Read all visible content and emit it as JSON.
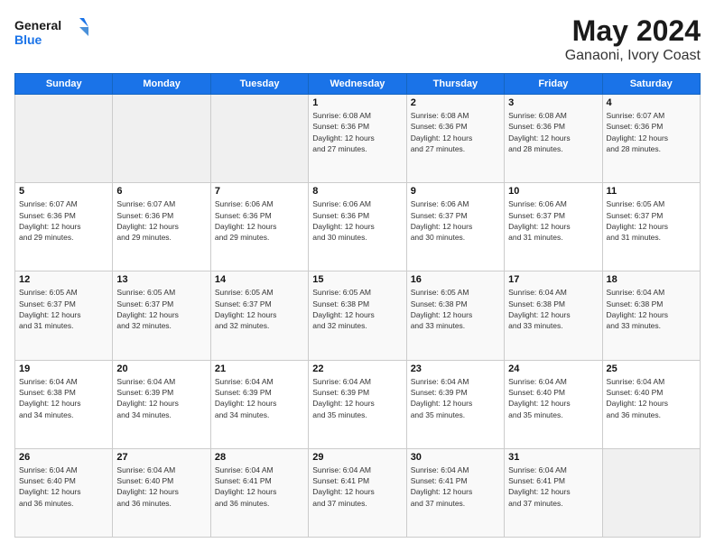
{
  "header": {
    "logo_line1": "General",
    "logo_line2": "Blue",
    "main_title": "May 2024",
    "subtitle": "Ganaoni, Ivory Coast"
  },
  "calendar": {
    "days_of_week": [
      "Sunday",
      "Monday",
      "Tuesday",
      "Wednesday",
      "Thursday",
      "Friday",
      "Saturday"
    ],
    "weeks": [
      [
        {
          "day": "",
          "info": ""
        },
        {
          "day": "",
          "info": ""
        },
        {
          "day": "",
          "info": ""
        },
        {
          "day": "1",
          "info": "Sunrise: 6:08 AM\nSunset: 6:36 PM\nDaylight: 12 hours\nand 27 minutes."
        },
        {
          "day": "2",
          "info": "Sunrise: 6:08 AM\nSunset: 6:36 PM\nDaylight: 12 hours\nand 27 minutes."
        },
        {
          "day": "3",
          "info": "Sunrise: 6:08 AM\nSunset: 6:36 PM\nDaylight: 12 hours\nand 28 minutes."
        },
        {
          "day": "4",
          "info": "Sunrise: 6:07 AM\nSunset: 6:36 PM\nDaylight: 12 hours\nand 28 minutes."
        }
      ],
      [
        {
          "day": "5",
          "info": "Sunrise: 6:07 AM\nSunset: 6:36 PM\nDaylight: 12 hours\nand 29 minutes."
        },
        {
          "day": "6",
          "info": "Sunrise: 6:07 AM\nSunset: 6:36 PM\nDaylight: 12 hours\nand 29 minutes."
        },
        {
          "day": "7",
          "info": "Sunrise: 6:06 AM\nSunset: 6:36 PM\nDaylight: 12 hours\nand 29 minutes."
        },
        {
          "day": "8",
          "info": "Sunrise: 6:06 AM\nSunset: 6:36 PM\nDaylight: 12 hours\nand 30 minutes."
        },
        {
          "day": "9",
          "info": "Sunrise: 6:06 AM\nSunset: 6:37 PM\nDaylight: 12 hours\nand 30 minutes."
        },
        {
          "day": "10",
          "info": "Sunrise: 6:06 AM\nSunset: 6:37 PM\nDaylight: 12 hours\nand 31 minutes."
        },
        {
          "day": "11",
          "info": "Sunrise: 6:05 AM\nSunset: 6:37 PM\nDaylight: 12 hours\nand 31 minutes."
        }
      ],
      [
        {
          "day": "12",
          "info": "Sunrise: 6:05 AM\nSunset: 6:37 PM\nDaylight: 12 hours\nand 31 minutes."
        },
        {
          "day": "13",
          "info": "Sunrise: 6:05 AM\nSunset: 6:37 PM\nDaylight: 12 hours\nand 32 minutes."
        },
        {
          "day": "14",
          "info": "Sunrise: 6:05 AM\nSunset: 6:37 PM\nDaylight: 12 hours\nand 32 minutes."
        },
        {
          "day": "15",
          "info": "Sunrise: 6:05 AM\nSunset: 6:38 PM\nDaylight: 12 hours\nand 32 minutes."
        },
        {
          "day": "16",
          "info": "Sunrise: 6:05 AM\nSunset: 6:38 PM\nDaylight: 12 hours\nand 33 minutes."
        },
        {
          "day": "17",
          "info": "Sunrise: 6:04 AM\nSunset: 6:38 PM\nDaylight: 12 hours\nand 33 minutes."
        },
        {
          "day": "18",
          "info": "Sunrise: 6:04 AM\nSunset: 6:38 PM\nDaylight: 12 hours\nand 33 minutes."
        }
      ],
      [
        {
          "day": "19",
          "info": "Sunrise: 6:04 AM\nSunset: 6:38 PM\nDaylight: 12 hours\nand 34 minutes."
        },
        {
          "day": "20",
          "info": "Sunrise: 6:04 AM\nSunset: 6:39 PM\nDaylight: 12 hours\nand 34 minutes."
        },
        {
          "day": "21",
          "info": "Sunrise: 6:04 AM\nSunset: 6:39 PM\nDaylight: 12 hours\nand 34 minutes."
        },
        {
          "day": "22",
          "info": "Sunrise: 6:04 AM\nSunset: 6:39 PM\nDaylight: 12 hours\nand 35 minutes."
        },
        {
          "day": "23",
          "info": "Sunrise: 6:04 AM\nSunset: 6:39 PM\nDaylight: 12 hours\nand 35 minutes."
        },
        {
          "day": "24",
          "info": "Sunrise: 6:04 AM\nSunset: 6:40 PM\nDaylight: 12 hours\nand 35 minutes."
        },
        {
          "day": "25",
          "info": "Sunrise: 6:04 AM\nSunset: 6:40 PM\nDaylight: 12 hours\nand 36 minutes."
        }
      ],
      [
        {
          "day": "26",
          "info": "Sunrise: 6:04 AM\nSunset: 6:40 PM\nDaylight: 12 hours\nand 36 minutes."
        },
        {
          "day": "27",
          "info": "Sunrise: 6:04 AM\nSunset: 6:40 PM\nDaylight: 12 hours\nand 36 minutes."
        },
        {
          "day": "28",
          "info": "Sunrise: 6:04 AM\nSunset: 6:41 PM\nDaylight: 12 hours\nand 36 minutes."
        },
        {
          "day": "29",
          "info": "Sunrise: 6:04 AM\nSunset: 6:41 PM\nDaylight: 12 hours\nand 37 minutes."
        },
        {
          "day": "30",
          "info": "Sunrise: 6:04 AM\nSunset: 6:41 PM\nDaylight: 12 hours\nand 37 minutes."
        },
        {
          "day": "31",
          "info": "Sunrise: 6:04 AM\nSunset: 6:41 PM\nDaylight: 12 hours\nand 37 minutes."
        },
        {
          "day": "",
          "info": ""
        }
      ]
    ]
  }
}
